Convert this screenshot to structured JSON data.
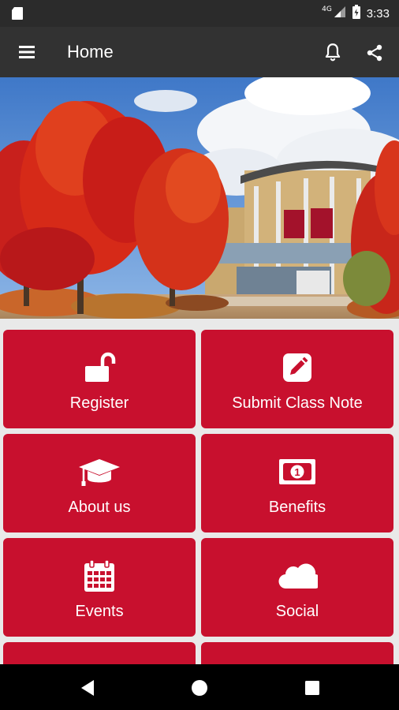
{
  "status": {
    "time": "3:33",
    "network": "4G"
  },
  "app_bar": {
    "title": "Home"
  },
  "tiles": [
    {
      "label": "Register",
      "icon": "unlock-icon"
    },
    {
      "label": "Submit Class Note",
      "icon": "edit-icon"
    },
    {
      "label": "About us",
      "icon": "graduation-cap-icon"
    },
    {
      "label": "Benefits",
      "icon": "money-icon"
    },
    {
      "label": "Events",
      "icon": "calendar-icon"
    },
    {
      "label": "Social",
      "icon": "cloud-icon"
    }
  ],
  "colors": {
    "accent": "#c8102e",
    "app_bar": "#323232",
    "status_bar": "#2b2b2b"
  }
}
